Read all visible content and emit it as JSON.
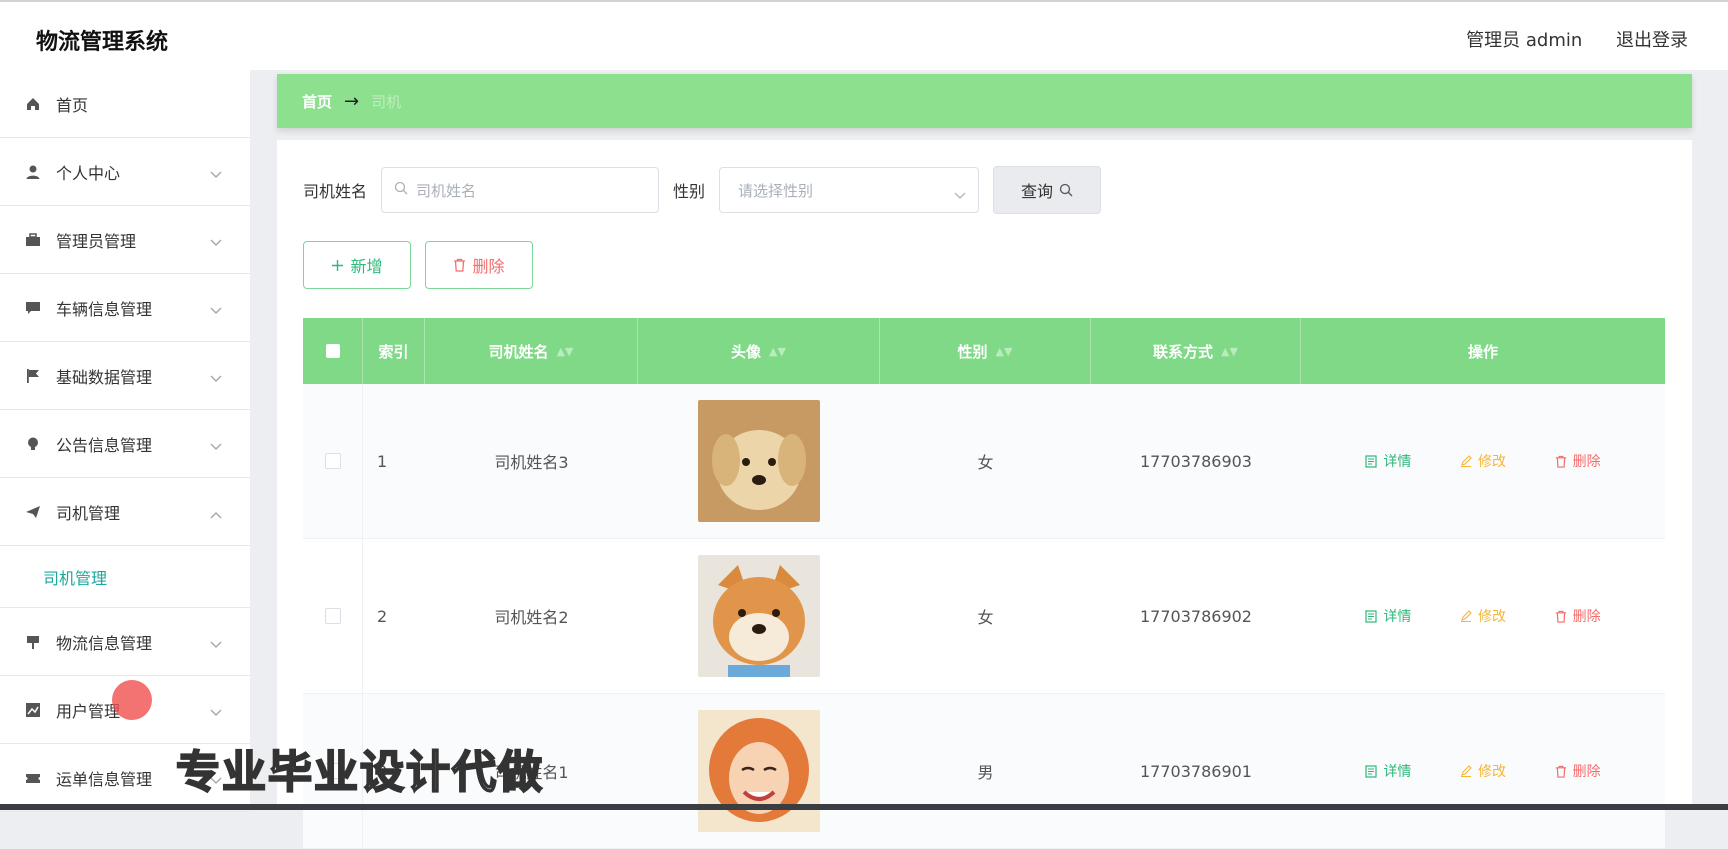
{
  "app": {
    "title": "物流管理系统"
  },
  "user": {
    "role_name": "管理员 admin",
    "logout": "退出登录"
  },
  "sidebar": {
    "items": [
      {
        "label": "首页",
        "icon": "home-icon"
      },
      {
        "label": "个人中心",
        "icon": "user-icon"
      },
      {
        "label": "管理员管理",
        "icon": "briefcase-icon"
      },
      {
        "label": "车辆信息管理",
        "icon": "chat-icon"
      },
      {
        "label": "基础数据管理",
        "icon": "flag-icon"
      },
      {
        "label": "公告信息管理",
        "icon": "bulb-icon"
      },
      {
        "label": "司机管理",
        "icon": "send-icon",
        "expanded": true,
        "children": [
          {
            "label": "司机管理"
          }
        ]
      },
      {
        "label": "物流信息管理",
        "icon": "sign-icon"
      },
      {
        "label": "用户管理",
        "icon": "chart-icon"
      },
      {
        "label": "运单信息管理",
        "icon": "ticket-icon"
      }
    ]
  },
  "breadcrumb": {
    "home": "首页",
    "current": "司机"
  },
  "search": {
    "name_label": "司机姓名",
    "name_placeholder": "司机姓名",
    "gender_label": "性别",
    "gender_placeholder": "请选择性别",
    "query_button": "查询"
  },
  "actions": {
    "add": "新增",
    "delete": "删除"
  },
  "table": {
    "headers": [
      "索引",
      "司机姓名",
      "头像",
      "性别",
      "联系方式",
      "操作"
    ],
    "rows": [
      {
        "index": "1",
        "name": "司机姓名3",
        "gender": "女",
        "phone": "17703786903",
        "avatar": "puppy-avatar"
      },
      {
        "index": "2",
        "name": "司机姓名2",
        "gender": "女",
        "phone": "17703786902",
        "avatar": "shiba-avatar"
      },
      {
        "index": "3",
        "name": "司机姓名1",
        "gender": "男",
        "phone": "17703786901",
        "avatar": "girl-avatar"
      }
    ],
    "row_actions": {
      "detail": "详情",
      "edit": "修改",
      "delete": "删除"
    }
  },
  "watermark": "专业毕业设计代做",
  "colors": {
    "header_green": "#7fd987",
    "breadcrumb_green": "#8ce08e",
    "accent_teal": "#1aa89c",
    "detail_green": "#2eb879",
    "edit_orange": "#f3b63a",
    "delete_red": "#f56c6c"
  }
}
